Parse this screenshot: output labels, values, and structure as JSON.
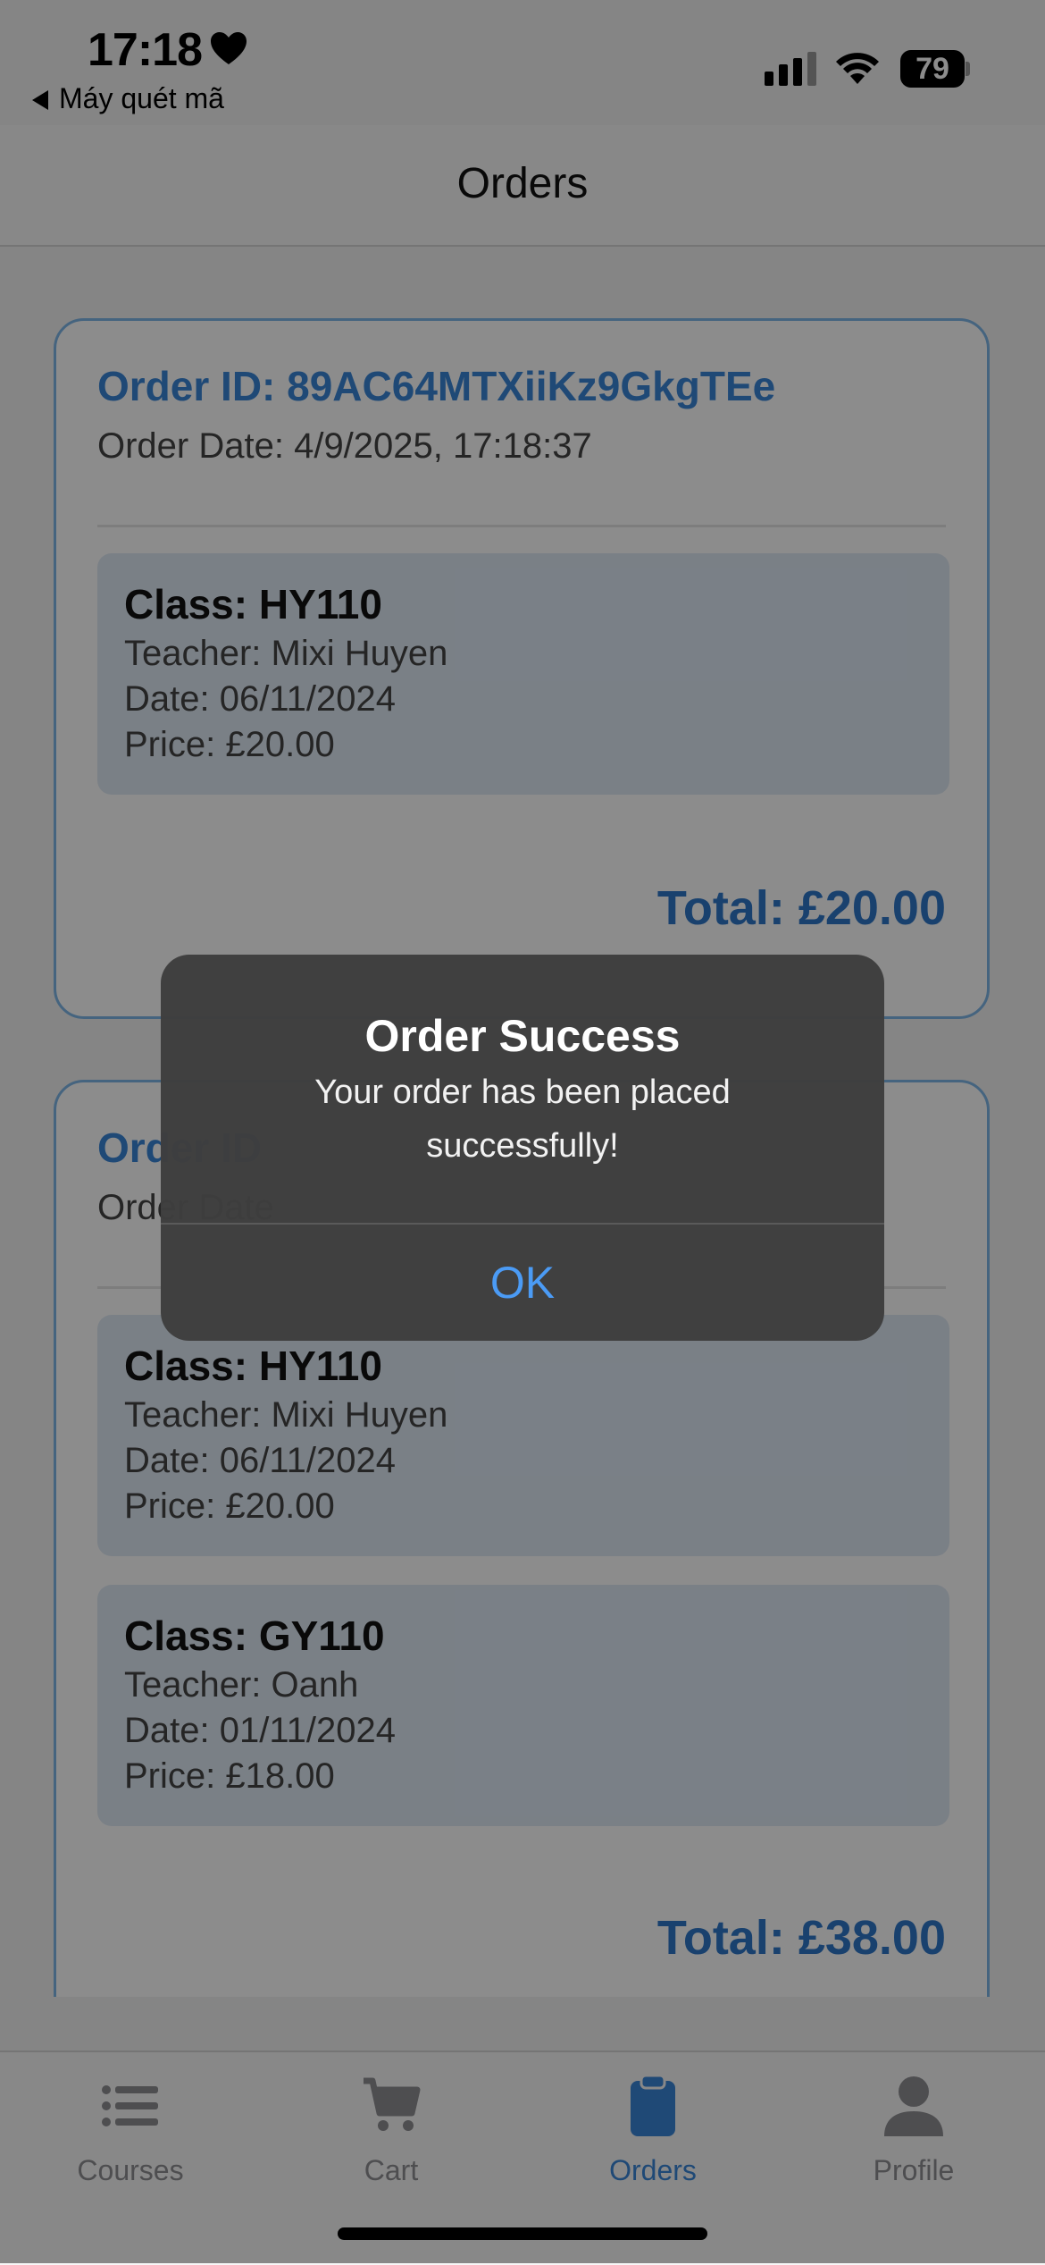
{
  "status_bar": {
    "time": "17:18",
    "back_app": "Máy quét mã",
    "battery": "79"
  },
  "header": {
    "title": "Orders"
  },
  "orders": [
    {
      "id_label": "Order ID: 89AC64MTXiiKz9GkgTEe",
      "date_label": "Order Date: 4/9/2025, 17:18:37",
      "items": [
        {
          "class_label": "Class: HY110",
          "teacher": "Teacher: Mixi Huyen",
          "date": "Date: 06/11/2024",
          "price": "Price: £20.00"
        }
      ],
      "total": "Total: £20.00"
    },
    {
      "id_label": "Order ID",
      "date_label": "Order Date",
      "items": [
        {
          "class_label": "Class: HY110",
          "teacher": "Teacher: Mixi Huyen",
          "date": "Date: 06/11/2024",
          "price": "Price: £20.00"
        },
        {
          "class_label": "Class: GY110",
          "teacher": "Teacher: Oanh",
          "date": "Date: 01/11/2024",
          "price": "Price: £18.00"
        }
      ],
      "total": "Total: £38.00"
    }
  ],
  "alert": {
    "title": "Order Success",
    "message": "Your order has been placed successfully!",
    "ok_label": "OK"
  },
  "tabs": [
    {
      "label": "Courses",
      "icon": "list-icon"
    },
    {
      "label": "Cart",
      "icon": "cart-icon"
    },
    {
      "label": "Orders",
      "icon": "clipboard-icon",
      "active": true
    },
    {
      "label": "Profile",
      "icon": "person-icon"
    }
  ],
  "colors": {
    "accent": "#3a86d8",
    "card_border": "#7fb6e8",
    "item_bg": "#dfe9f5",
    "alert_button": "#4b9bf5"
  }
}
